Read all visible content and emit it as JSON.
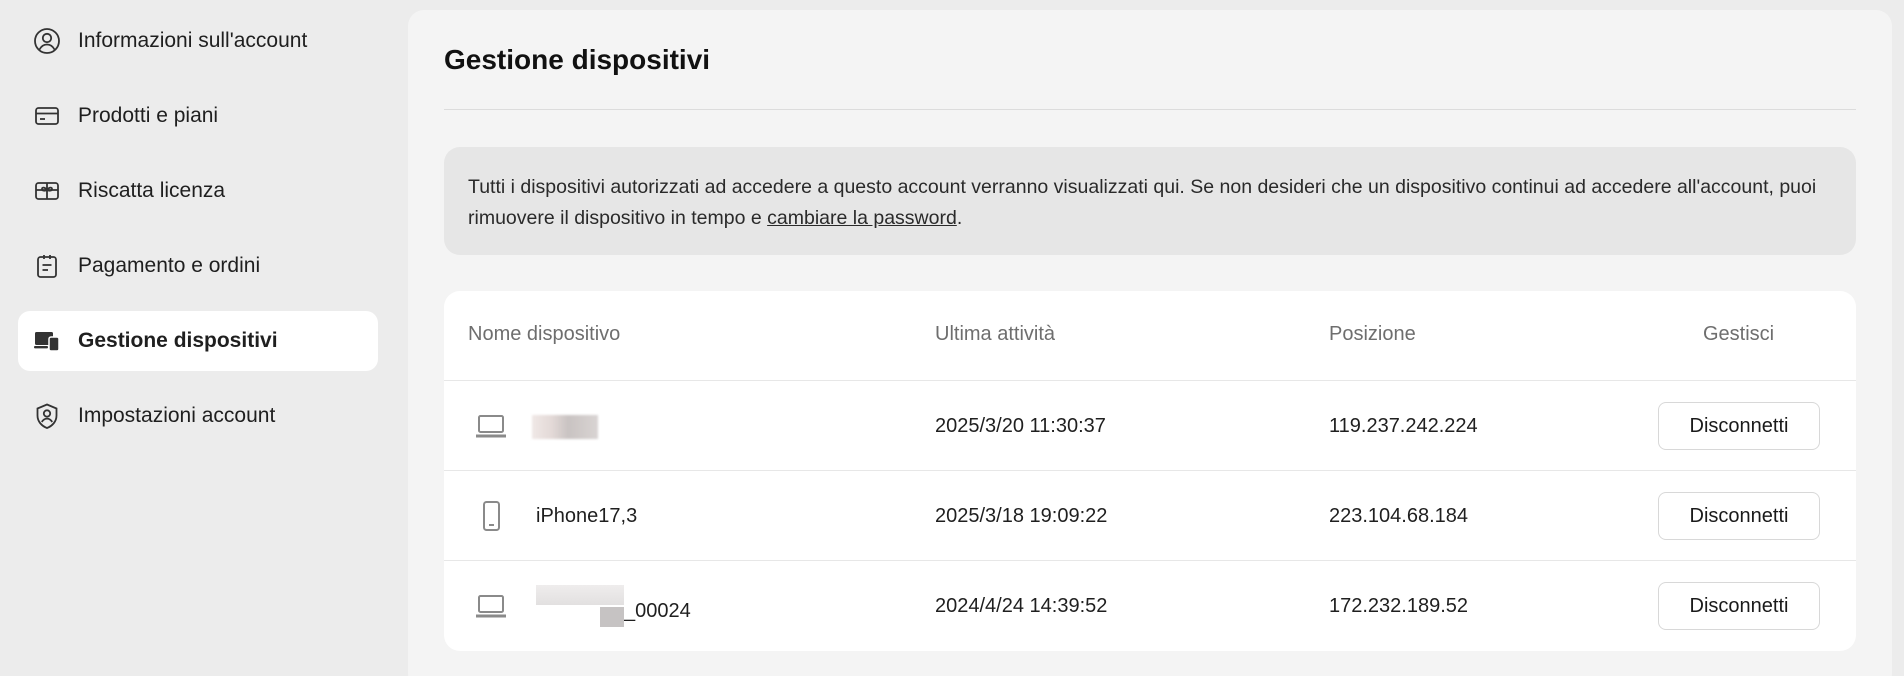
{
  "sidebar": {
    "items": [
      {
        "label": "Informazioni sull'account",
        "icon": "user-circle-icon",
        "active": false
      },
      {
        "label": "Prodotti e piani",
        "icon": "card-icon",
        "active": false
      },
      {
        "label": "Riscatta licenza",
        "icon": "gift-icon",
        "active": false
      },
      {
        "label": "Pagamento e ordini",
        "icon": "clipboard-icon",
        "active": false
      },
      {
        "label": "Gestione dispositivi",
        "icon": "devices-icon",
        "active": true
      },
      {
        "label": "Impostazioni account",
        "icon": "shield-user-icon",
        "active": false
      }
    ]
  },
  "main": {
    "title": "Gestione dispositivi",
    "notice": {
      "text": "Tutti i dispositivi autorizzati ad accedere a questo account verranno visualizzati qui. Se non desideri che un dispositivo continui ad accedere all'account, puoi rimuovere il dispositivo in tempo e ",
      "link": "cambiare la password",
      "suffix": "."
    },
    "table": {
      "headers": {
        "name": "Nome dispositivo",
        "last_activity": "Ultima attività",
        "location": "Posizione",
        "manage": "Gestisci"
      },
      "rows": [
        {
          "type": "laptop-icon",
          "name": "",
          "last_activity": "2025/3/20 11:30:37",
          "location": "119.237.242.224",
          "action": "Disconnetti"
        },
        {
          "type": "phone-icon",
          "name": "iPhone17,3",
          "last_activity": "2025/3/18 19:09:22",
          "location": "223.104.68.184",
          "action": "Disconnetti"
        },
        {
          "type": "laptop-icon",
          "name": "_00024",
          "last_activity": "2024/4/24 14:39:52",
          "location": "172.232.189.52",
          "action": "Disconnetti"
        }
      ]
    }
  }
}
